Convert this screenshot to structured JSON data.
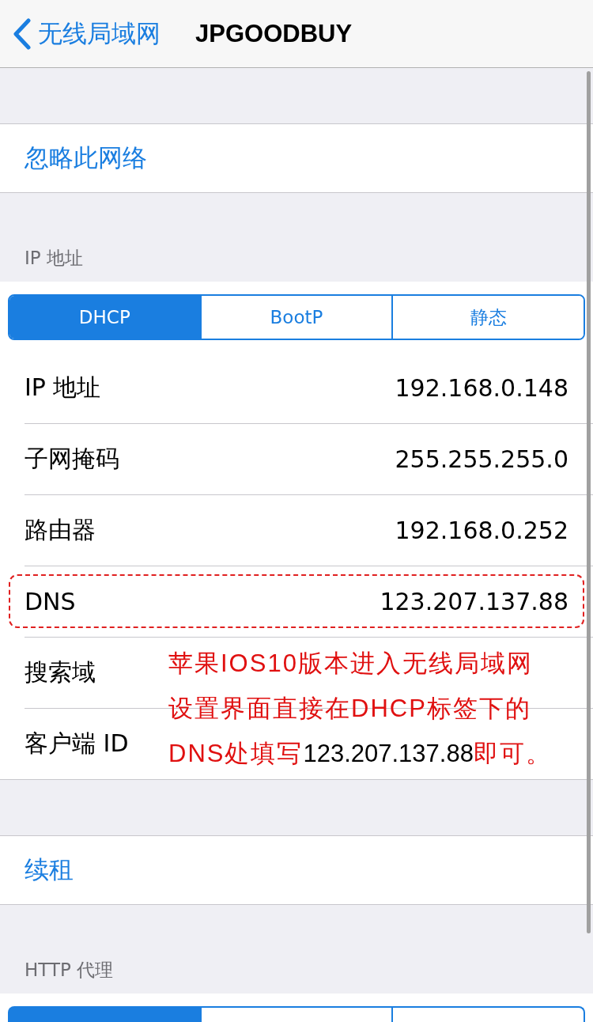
{
  "nav": {
    "back_label": "无线局域网",
    "title": "JPGOODBUY"
  },
  "forget": {
    "label": "忽略此网络"
  },
  "ip_section": {
    "header": "IP 地址",
    "segments": [
      {
        "label": "DHCP",
        "selected": true
      },
      {
        "label": "BootP",
        "selected": false
      },
      {
        "label": "静态",
        "selected": false
      }
    ],
    "rows": [
      {
        "label": "IP 地址",
        "value": "192.168.0.148",
        "highlighted": false
      },
      {
        "label": "子网掩码",
        "value": "255.255.255.0",
        "highlighted": false
      },
      {
        "label": "路由器",
        "value": "192.168.0.252",
        "highlighted": false
      },
      {
        "label": "DNS",
        "value": "123.207.137.88",
        "highlighted": true
      },
      {
        "label": "搜索域",
        "highlighted": false
      },
      {
        "label": "客户端 ID",
        "highlighted": false
      }
    ]
  },
  "annotation": {
    "parts": [
      {
        "text": "苹果IOS10版本进入无线局域网设置界面直接在DHCP标签下的DNS处填写",
        "kind": "emphasis"
      },
      {
        "text": "123.207.137.88",
        "kind": "plain"
      },
      {
        "text": "即可。",
        "kind": "emphasis"
      }
    ]
  },
  "renew": {
    "label": "续租"
  },
  "http_proxy": {
    "header": "HTTP 代理",
    "segments": [
      {
        "selected": true
      },
      {
        "selected": false
      },
      {
        "selected": false
      }
    ]
  }
}
